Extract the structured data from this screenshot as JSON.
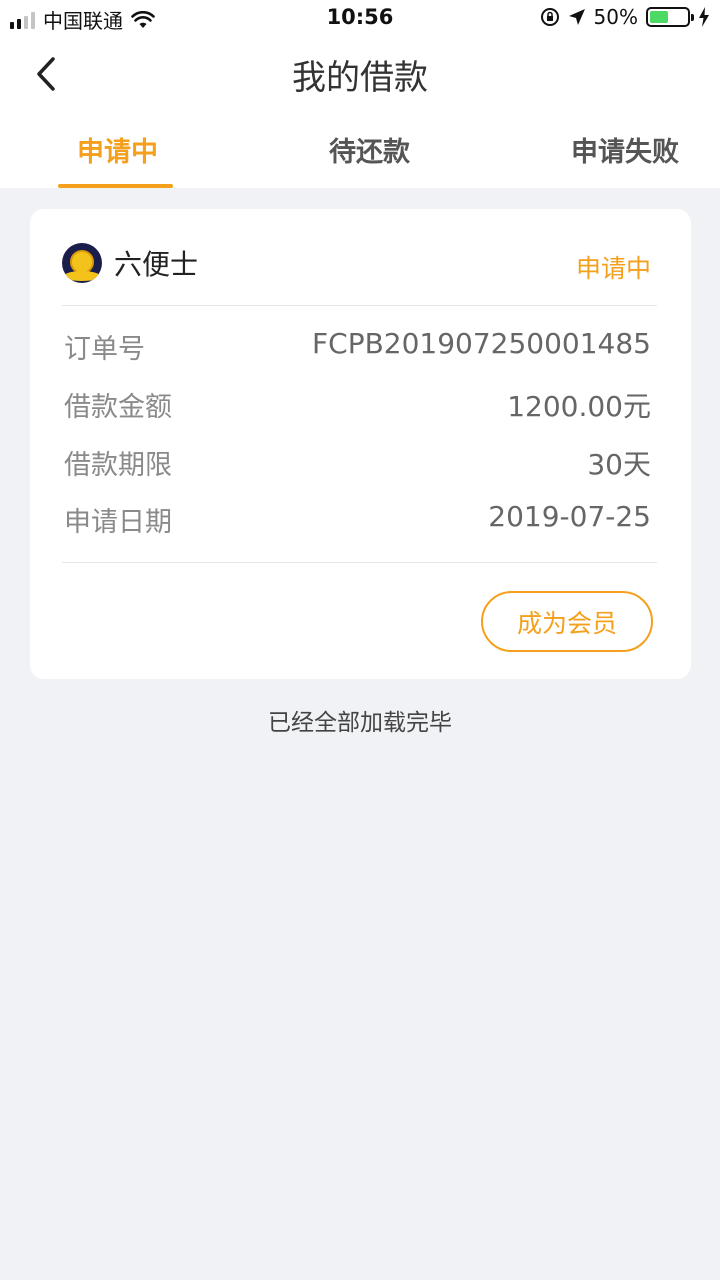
{
  "status_bar": {
    "carrier": "中国联通",
    "time": "10:56",
    "battery_percent": "50%",
    "battery_level": 0.5,
    "battery_color": "#4cd964",
    "icons": [
      "signal-icon",
      "wifi-icon",
      "orientation-lock-icon",
      "location-icon",
      "battery-icon",
      "charging-icon"
    ]
  },
  "nav": {
    "title": "我的借款",
    "back_icon": "chevron-left-icon"
  },
  "tabs": [
    {
      "label": "申请中",
      "active": true
    },
    {
      "label": "待还款",
      "active": false
    },
    {
      "label": "申请失败",
      "active": false
    }
  ],
  "card": {
    "company": "六便士",
    "status": "申请中",
    "rows": [
      {
        "label": "订单号",
        "value": "FCPB201907250001485"
      },
      {
        "label": "借款金额",
        "value": "1200.00元"
      },
      {
        "label": "借款期限",
        "value": "30天"
      },
      {
        "label": "申请日期",
        "value": "2019-07-25"
      }
    ],
    "button_label": "成为会员"
  },
  "footer_text": "已经全部加载完毕",
  "colors": {
    "accent": "#f5a01c",
    "background": "#f1f2f6"
  }
}
